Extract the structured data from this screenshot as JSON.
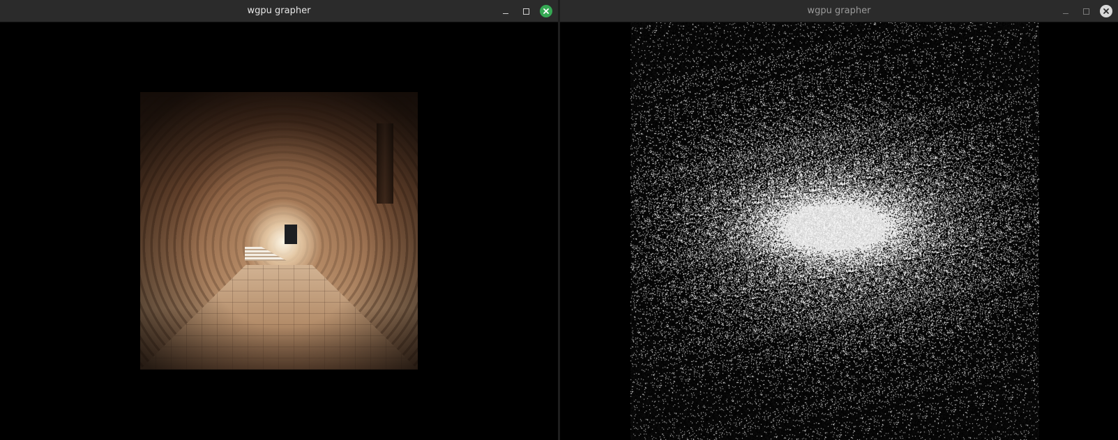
{
  "windows": [
    {
      "title": "wgpu grapher",
      "state": "focused",
      "controls": {
        "minimize": "minimize-icon",
        "maximize": "maximize-icon",
        "close": "close-icon"
      },
      "colors": {
        "close": "#35a853"
      }
    },
    {
      "title": "wgpu grapher",
      "state": "unfocused",
      "controls": {
        "minimize": "minimize-icon",
        "maximize": "maximize-icon",
        "close": "close-icon"
      },
      "colors": {
        "close": "#d8d8d8"
      }
    }
  ]
}
